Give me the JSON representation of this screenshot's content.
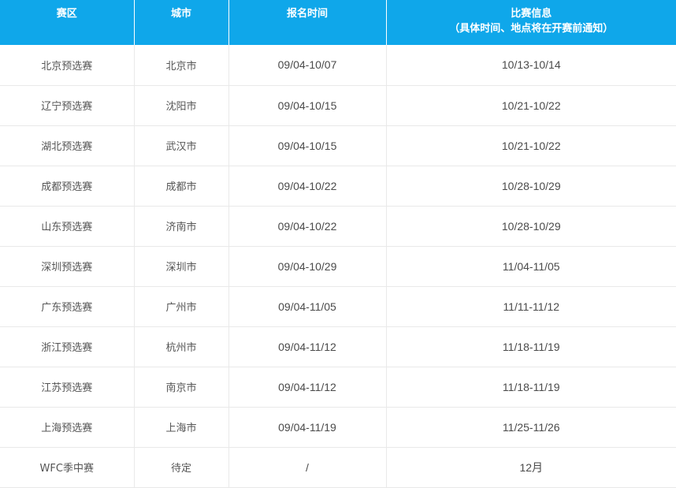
{
  "header": {
    "region": "赛区",
    "city": "城市",
    "signup": "报名时间",
    "match_info": "比赛信息",
    "match_info_note": "（具体时间、地点将在开赛前通知）"
  },
  "rows": [
    {
      "region": "北京预选赛",
      "city": "北京市",
      "signup": "09/04-10/07",
      "match": "10/13-10/14"
    },
    {
      "region": "辽宁预选赛",
      "city": "沈阳市",
      "signup": "09/04-10/15",
      "match": "10/21-10/22"
    },
    {
      "region": "湖北预选赛",
      "city": "武汉市",
      "signup": "09/04-10/15",
      "match": "10/21-10/22"
    },
    {
      "region": "成都预选赛",
      "city": "成都市",
      "signup": "09/04-10/22",
      "match": "10/28-10/29"
    },
    {
      "region": "山东预选赛",
      "city": "济南市",
      "signup": "09/04-10/22",
      "match": "10/28-10/29"
    },
    {
      "region": "深圳预选赛",
      "city": "深圳市",
      "signup": "09/04-10/29",
      "match": "11/04-11/05"
    },
    {
      "region": "广东预选赛",
      "city": "广州市",
      "signup": "09/04-11/05",
      "match": "11/11-11/12"
    },
    {
      "region": "浙江预选赛",
      "city": "杭州市",
      "signup": "09/04-11/12",
      "match": "11/18-11/19"
    },
    {
      "region": "江苏预选赛",
      "city": "南京市",
      "signup": "09/04-11/12",
      "match": "11/18-11/19"
    },
    {
      "region": "上海预选赛",
      "city": "上海市",
      "signup": "09/04-11/19",
      "match": "11/25-11/26"
    },
    {
      "region": "WFC季中赛",
      "city": "待定",
      "signup": "/",
      "match": "12月"
    }
  ],
  "colors": {
    "header_bg": "#0fa7ea",
    "header_text": "#ffffff",
    "cell_text": "#555555",
    "grid_line": "#e9e9e9"
  }
}
